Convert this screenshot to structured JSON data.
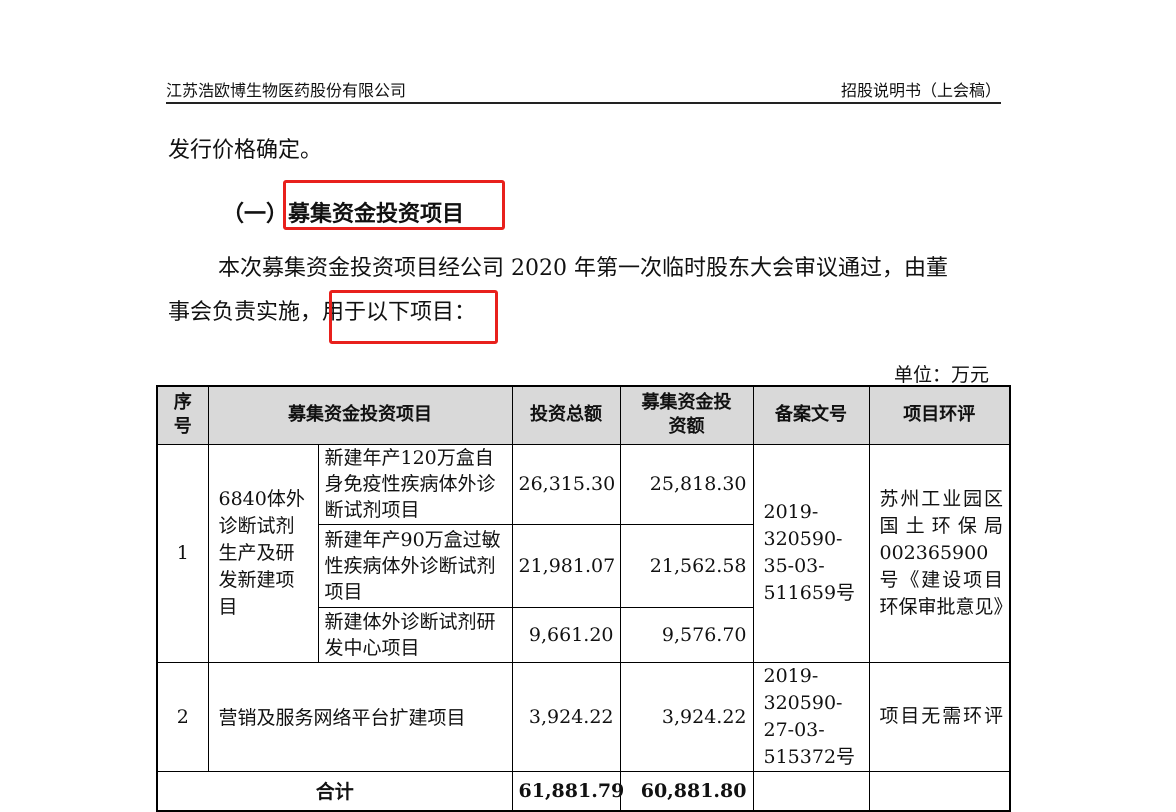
{
  "header": {
    "company": "江苏浩欧博生物医药股份有限公司",
    "doc_type": "招股说明书（上会稿）"
  },
  "body": {
    "para1": "发行价格确定。",
    "heading_prefix": "（一）",
    "heading_title": "募集资金投资项目",
    "para2_line1": "本次募集资金投资项目经公司 2020 年第一次临时股东大会审议通过，由董",
    "para2_line2_prefix": "事会负责实施，",
    "para2_line2_highlight": "用于以下项目："
  },
  "unit": "单位：万元",
  "table": {
    "headers": {
      "seq": "序号",
      "project": "募集资金投资项目",
      "total": "投资总额",
      "raised": "募集资金投资额",
      "filing": "备案文号",
      "env": "项目环评"
    },
    "rows": [
      {
        "seq": "1",
        "group": "6840体外诊断试剂生产及研发新建项目",
        "subs": [
          {
            "name": "新建年产120万盒自身免疫性疾病体外诊断试剂项目",
            "total": "26,315.30",
            "raised": "25,818.30"
          },
          {
            "name": "新建年产90万盒过敏性疾病体外诊断试剂项目",
            "total": "21,981.07",
            "raised": "21,562.58"
          },
          {
            "name": "新建体外诊断试剂研发中心项目",
            "total": "9,661.20",
            "raised": "9,576.70"
          }
        ],
        "filing": "2019-320590-35-03-511659号",
        "env": "苏州工业园区国土环保局002365900号《建设项目环保审批意见》"
      },
      {
        "seq": "2",
        "name": "营销及服务网络平台扩建项目",
        "total": "3,924.22",
        "raised": "3,924.22",
        "filing": "2019-320590-27-03-515372号",
        "env": "项目无需环评"
      }
    ],
    "total_row": {
      "label": "合计",
      "total": "61,881.79",
      "raised": "60,881.80"
    }
  }
}
